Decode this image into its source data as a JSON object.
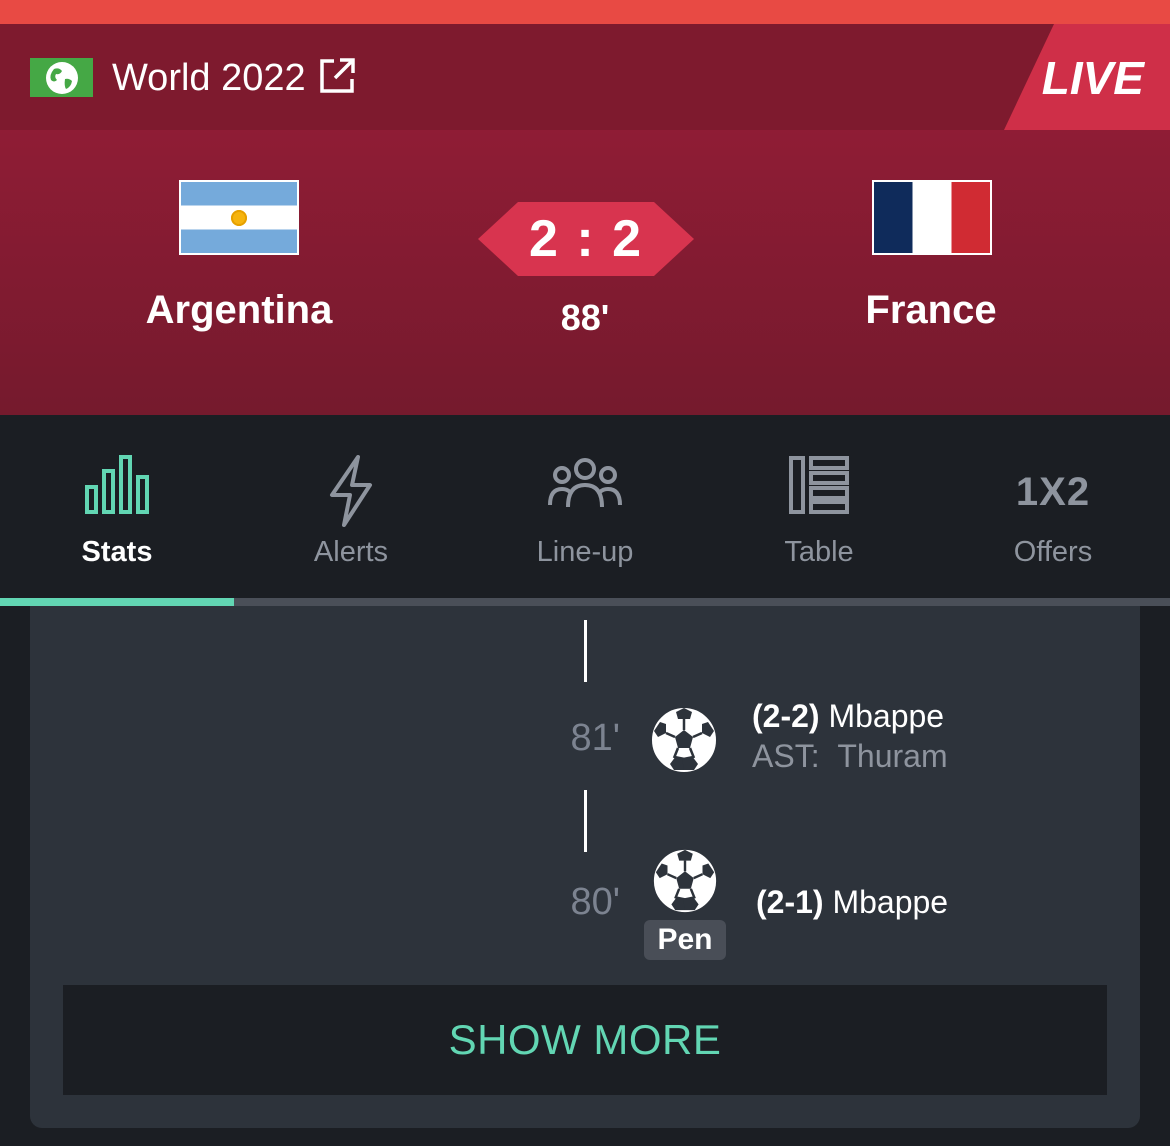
{
  "header": {
    "competition": "World 2022",
    "live": "LIVE"
  },
  "match": {
    "home_team": "Argentina",
    "away_team": "France",
    "score": "2 : 2",
    "minute": "88'"
  },
  "tabs": [
    {
      "label": "Stats",
      "icon": "stats-bars-icon",
      "active": true
    },
    {
      "label": "Alerts",
      "icon": "lightning-icon",
      "active": false
    },
    {
      "label": "Line-up",
      "icon": "people-group-icon",
      "active": false
    },
    {
      "label": "Table",
      "icon": "table-icon",
      "active": false
    },
    {
      "label": "Offers",
      "icon": "odds-1x2-icon",
      "active": false
    }
  ],
  "offers_icon_text": "1X2",
  "events": [
    {
      "minute": "81'",
      "score": "(2-2)",
      "player": "Mbappe",
      "assist_label": "AST:",
      "assist": "Thuram",
      "icon": "soccer-ball-icon"
    },
    {
      "minute": "80'",
      "score": "(2-1)",
      "player": "Mbappe",
      "badge": "Pen",
      "icon": "soccer-ball-icon"
    }
  ],
  "show_more": "SHOW MORE",
  "colors": {
    "accent": "#62d6b3",
    "live_red": "#cf2f48",
    "header_bg": "#7e1a2e",
    "score_bg": "#d8344f"
  }
}
